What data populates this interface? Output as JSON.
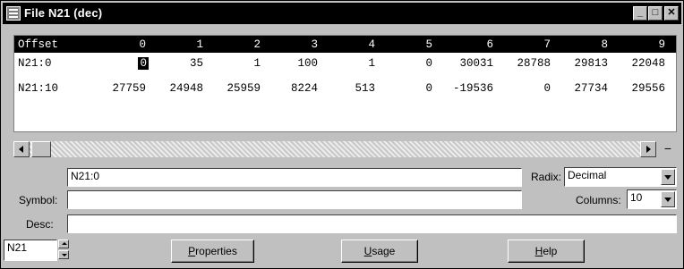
{
  "window": {
    "title": "File N21 (dec)",
    "controls": {
      "minimize": "_",
      "maximize": "□",
      "close": "✕"
    }
  },
  "grid": {
    "columns": [
      "Offset",
      "0",
      "1",
      "2",
      "3",
      "4",
      "5",
      "6",
      "7",
      "8",
      "9"
    ],
    "rows": [
      {
        "offset": "N21:0",
        "values": [
          "0",
          "35",
          "1",
          "100",
          "1",
          "0",
          "30031",
          "28788",
          "29813",
          "22048"
        ]
      },
      {
        "offset": "N21:10",
        "values": [
          "27759",
          "24948",
          "25959",
          "8224",
          "513",
          "0",
          "-19536",
          "0",
          "27734",
          "29556"
        ]
      }
    ],
    "selected_cell": "N21:0/0"
  },
  "scrollbar": {
    "minus_label": "−"
  },
  "address": {
    "value": "N21:0"
  },
  "radix": {
    "label": "Radix:",
    "value": "Decimal"
  },
  "symbol": {
    "label": "Symbol:",
    "value": ""
  },
  "columns": {
    "label": "Columns:",
    "value": "10"
  },
  "desc": {
    "label": "Desc:",
    "value": ""
  },
  "file_select": {
    "value": "N21"
  },
  "buttons": {
    "properties": {
      "accel": "P",
      "rest": "roperties"
    },
    "usage": {
      "accel": "U",
      "rest": "sage"
    },
    "help": {
      "accel": "H",
      "rest": "elp"
    }
  }
}
